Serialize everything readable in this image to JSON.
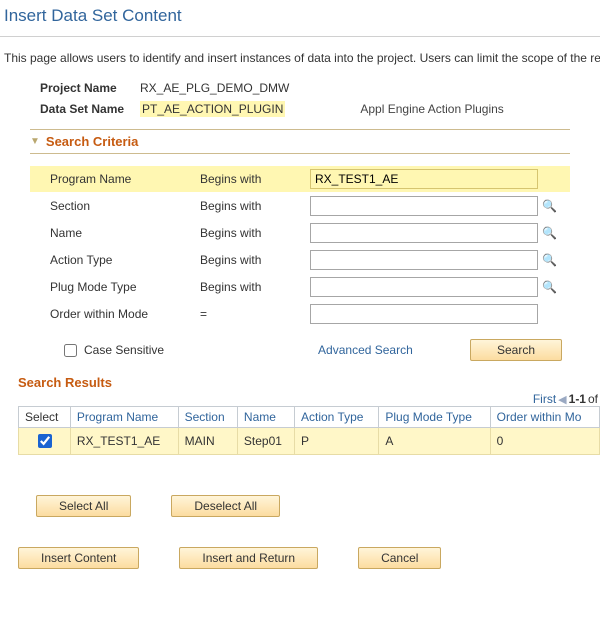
{
  "page": {
    "title": "Insert Data Set Content",
    "intro": "This page allows users to identify and insert instances of data into the project. Users can limit the scope of the re"
  },
  "header": {
    "project_label": "Project Name",
    "project_value": "RX_AE_PLG_DEMO_DMW",
    "dataset_label": "Data Set Name",
    "dataset_value": "PT_AE_ACTION_PLUGIN",
    "dataset_desc": "Appl Engine Action Plugins"
  },
  "criteria": {
    "title": "Search Criteria",
    "rows": [
      {
        "label": "Program Name",
        "op": "Begins with",
        "value": "RX_TEST1_AE",
        "hl": true,
        "lookup": false
      },
      {
        "label": "Section",
        "op": "Begins with",
        "value": "",
        "hl": false,
        "lookup": true
      },
      {
        "label": "Name",
        "op": "Begins with",
        "value": "",
        "hl": false,
        "lookup": true
      },
      {
        "label": "Action Type",
        "op": "Begins with",
        "value": "",
        "hl": false,
        "lookup": true
      },
      {
        "label": "Plug Mode Type",
        "op": "Begins with",
        "value": "",
        "hl": false,
        "lookup": true
      },
      {
        "label": "Order within Mode",
        "op": "=",
        "value": "",
        "hl": false,
        "lookup": false
      }
    ],
    "case_label": "Case Sensitive",
    "advanced": "Advanced Search",
    "search_btn": "Search"
  },
  "results": {
    "title": "Search Results",
    "pager_first": "First",
    "pager_range": "1-1",
    "pager_of": " of",
    "columns": [
      "Select",
      "Program Name",
      "Section",
      "Name",
      "Action Type",
      "Plug Mode Type",
      "Order within Mo"
    ],
    "rows": [
      {
        "selected": true,
        "program": "RX_TEST1_AE",
        "section": "MAIN",
        "name": "Step01",
        "action_type": "P",
        "plug_mode": "A",
        "order": "0"
      }
    ],
    "select_all": "Select All",
    "deselect_all": "Deselect All"
  },
  "actions": {
    "insert": "Insert Content",
    "insert_return": "Insert and Return",
    "cancel": "Cancel"
  }
}
